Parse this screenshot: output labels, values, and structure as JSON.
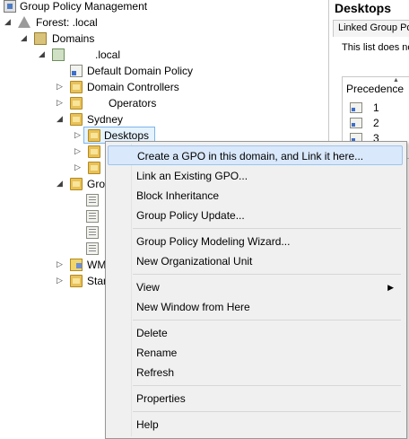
{
  "tree": {
    "root": "Group Policy Management",
    "forest": "Forest:          .local",
    "domains": "Domains",
    "domain": ".local",
    "items": {
      "default_policy": "Default Domain Policy",
      "domain_controllers": "Domain Controllers",
      "operators": "Operators",
      "sydney": "Sydney",
      "desktops": "Desktops",
      "gro": "Gro",
      "wm": "WM",
      "star": "Star"
    }
  },
  "right_pane": {
    "title": "Desktops",
    "tab": "Linked Group Po",
    "note": "This list does no",
    "column": "Precedence",
    "rows": [
      "1",
      "2",
      "3"
    ]
  },
  "context_menu": {
    "items": [
      "Create a GPO in this domain, and Link it here...",
      "Link an Existing GPO...",
      "Block Inheritance",
      "Group Policy Update...",
      "Group Policy Modeling Wizard...",
      "New Organizational Unit",
      "View",
      "New Window from Here",
      "Delete",
      "Rename",
      "Refresh",
      "Properties",
      "Help"
    ],
    "highlighted_index": 0
  },
  "icons": [
    "gpm-icon",
    "forest-icon",
    "domains-icon",
    "domain-icon",
    "gpo-link-icon",
    "ou-folder-icon",
    "gpo-icon",
    "wmi-filter-icon",
    "expand-arrow-icon",
    "collapse-arrow-icon",
    "submenu-arrow-icon"
  ]
}
